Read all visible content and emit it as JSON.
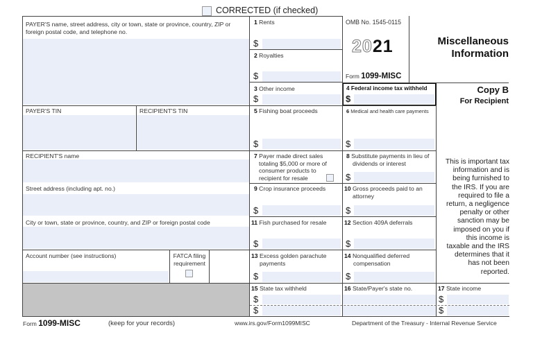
{
  "header": {
    "corrected_label": "CORRECTED (if checked)"
  },
  "payer": {
    "name_label": "PAYER'S name, street address, city or town, state or province, country, ZIP or foreign postal code, and telephone no.",
    "name_value": "",
    "tin_label": "PAYER'S TIN",
    "tin_value": ""
  },
  "recipient": {
    "tin_label": "RECIPIENT'S TIN",
    "tin_value": "",
    "name_label": "RECIPIENT'S name",
    "name_value": "",
    "street_label": "Street address (including apt. no.)",
    "street_value": "",
    "city_label": "City or town, state or province, country, and ZIP or foreign postal code",
    "city_value": "",
    "account_label": "Account number (see instructions)",
    "account_value": "",
    "fatca_label_1": "FATCA filing",
    "fatca_label_2": "requirement"
  },
  "form_info": {
    "omb": "OMB No. 1545-0115",
    "year_outline": "20",
    "year_bold": "21",
    "form_prefix": "Form",
    "form_name": "1099-MISC",
    "title_line1": "Miscellaneous",
    "title_line2": "Information",
    "copy": "Copy B",
    "for_whom": "For Recipient",
    "notice": [
      "This is important tax",
      "information and is",
      "being furnished to",
      "the IRS. If you are",
      "required to file a",
      "return, a negligence",
      "penalty or other",
      "sanction may be",
      "imposed on you if",
      "this income is",
      "taxable and the IRS",
      "determines that it",
      "has not been",
      "reported."
    ]
  },
  "boxes": {
    "b1": {
      "num": "1",
      "label": "Rents",
      "value": ""
    },
    "b2": {
      "num": "2",
      "label": "Royalties",
      "value": ""
    },
    "b3": {
      "num": "3",
      "label": "Other income",
      "value": ""
    },
    "b4": {
      "num": "4",
      "label": "Federal income tax withheld",
      "value": ""
    },
    "b5": {
      "num": "5",
      "label": "Fishing boat proceeds",
      "value": ""
    },
    "b6": {
      "num": "6",
      "label": "Medical and health care payments",
      "value": ""
    },
    "b7": {
      "num": "7",
      "label_lines": [
        "Payer made direct sales",
        "totaling $5,000 or more of",
        "consumer products to",
        "recipient for resale"
      ]
    },
    "b8": {
      "num": "8",
      "label_lines": [
        "Substitute payments in lieu of",
        "dividends or interest"
      ],
      "value": ""
    },
    "b9": {
      "num": "9",
      "label": "Crop insurance proceeds",
      "value": ""
    },
    "b10": {
      "num": "10",
      "label_lines": [
        "Gross proceeds paid to an",
        "attorney"
      ],
      "value": ""
    },
    "b11": {
      "num": "11",
      "label": "Fish purchased for resale",
      "value": ""
    },
    "b12": {
      "num": "12",
      "label": "Section 409A deferrals",
      "value": ""
    },
    "b13": {
      "num": "13",
      "label_lines": [
        "Excess golden parachute",
        "payments"
      ],
      "value": ""
    },
    "b14": {
      "num": "14",
      "label_lines": [
        "Nonqualified deferred",
        "compensation"
      ],
      "value": ""
    },
    "b15": {
      "num": "15",
      "label": "State tax withheld",
      "value1": "",
      "value2": ""
    },
    "b16": {
      "num": "16",
      "label": "State/Payer's state no.",
      "value1": "",
      "value2": ""
    },
    "b17": {
      "num": "17",
      "label": "State income",
      "value1": "",
      "value2": ""
    }
  },
  "currency_symbol": "$",
  "footer": {
    "form_prefix": "Form",
    "form_name": "1099-MISC",
    "keep": "(keep for your records)",
    "url": "www.irs.gov/Form1099MISC",
    "dept": "Department of the Treasury - Internal Revenue Service"
  }
}
